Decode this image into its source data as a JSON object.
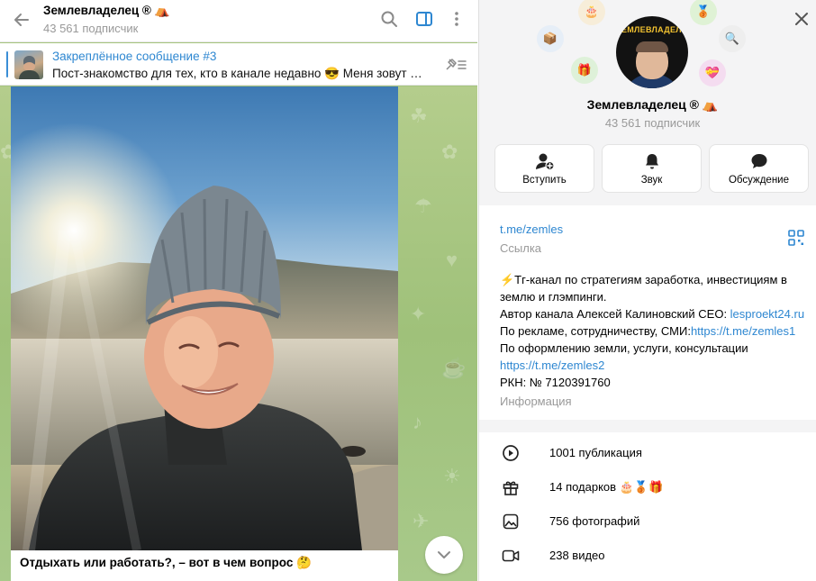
{
  "header": {
    "title": "Землевладелец ® ⛺",
    "subtitle": "43 561 подписчик"
  },
  "pinned": {
    "title": "Закреплённое сообщение #3",
    "text": "Пост-знакомство для тех, кто в канале недавно 😎 Меня зовут А..."
  },
  "post": {
    "caption": "Отдыхать или работать?, –  вот в чем вопрос 🤔"
  },
  "profile": {
    "avatar_logo": "ЗЕМЛЕВЛАДЕЛЕЦ",
    "name": "Землевладелец ® ⛺",
    "subscribers": "43 561 подписчик",
    "actions": {
      "join": "Вступить",
      "sound": "Звук",
      "discussion": "Обсуждение"
    },
    "gifts_orbit": [
      "🎂",
      "🥉",
      "📦",
      "🔍",
      "🎁",
      "💝"
    ],
    "link": "t.me/zemles",
    "link_label": "Ссылка",
    "bio": {
      "line1": "⚡Тг-канал по стратегиям заработка, инвестициям в",
      "line2": "землю и глэмпинги.",
      "line3_prefix": "Автор канала Алексей Калиновский СЕО: ",
      "line3_link": "lesproekt24.ru",
      "line4_prefix": "По рекламе, сотрудничеству, СМИ:",
      "line4_link": "https://t.me/zemles1",
      "line5": "По оформлению земли, услуги, консультации",
      "line6_link": "https://t.me/zemles2",
      "line7": "РКН: № 7120391760"
    },
    "info_label": "Информация",
    "stats": {
      "posts": "1001 публикация",
      "gifts": "14 подарков",
      "gifts_emoji": "🎂🥉🎁",
      "photos": "756 фотографий",
      "videos": "238 видео"
    }
  },
  "colors": {
    "accent": "#2e87d1",
    "wallpaper": "#a6c57e",
    "muted": "#999999"
  }
}
